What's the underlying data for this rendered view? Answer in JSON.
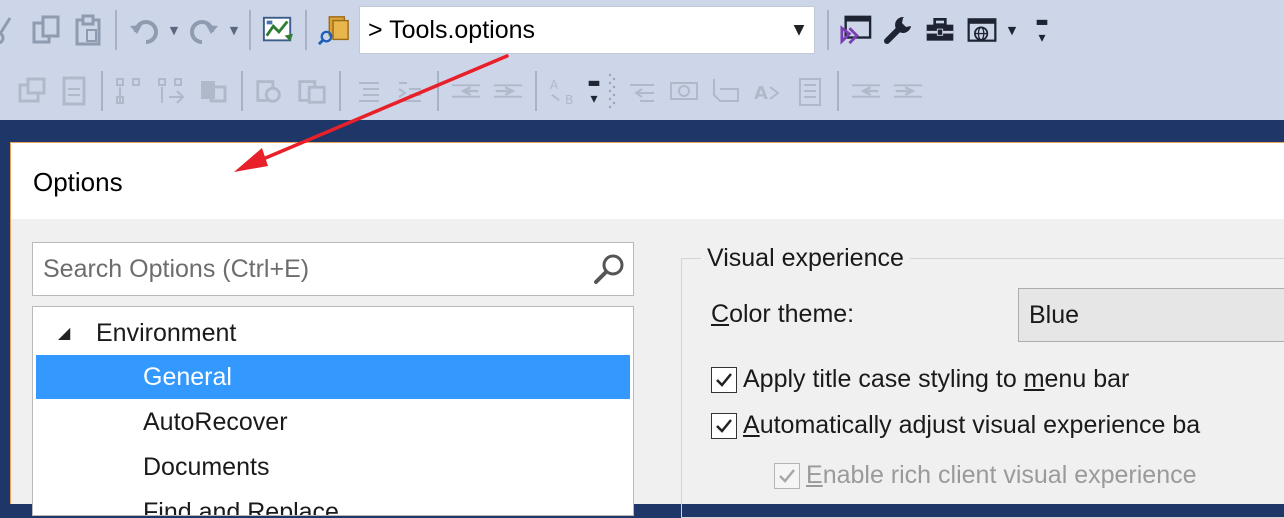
{
  "command_box": {
    "value": "> Tools.options"
  },
  "dialog": {
    "title": "Options",
    "search": {
      "placeholder": "Search Options (Ctrl+E)"
    },
    "tree": [
      {
        "label": "Environment",
        "expanded": true,
        "level": 0
      },
      {
        "label": "General",
        "level": 1,
        "selected": true
      },
      {
        "label": "AutoRecover",
        "level": 1
      },
      {
        "label": "Documents",
        "level": 1
      },
      {
        "label": "Find and Replace",
        "level": 1
      }
    ],
    "visual": {
      "group_label": "Visual experience",
      "color_theme_label_pre": "",
      "color_theme_label_ul": "C",
      "color_theme_label_post": "olor theme:",
      "color_theme_value": "Blue",
      "checkboxes": [
        {
          "pre": "Apply title case styling to ",
          "ul": "m",
          "post": "enu bar",
          "checked": true,
          "enabled": true
        },
        {
          "pre": "",
          "ul": "A",
          "post": "utomatically adjust visual experience ba",
          "checked": true,
          "enabled": true
        },
        {
          "pre": "",
          "ul": "E",
          "post": "nable rich client visual experience",
          "checked": true,
          "enabled": false
        }
      ]
    }
  },
  "colors": {
    "toolbar_bg": "#cdd6e8",
    "shell_bg": "#1f3668",
    "selection": "#3399ff",
    "dialog_border": "#e9a35e",
    "annotation_arrow": "#e8202a"
  },
  "icons": {
    "toolbar_row1": [
      "cut-icon",
      "copy-icon",
      "paste-icon",
      "undo-icon",
      "redo-icon",
      "chart-icon",
      "find-in-files-icon",
      "vs-project-icon",
      "wrench-icon",
      "toolbox-icon",
      "browser-icon"
    ],
    "toolbar_row2": [
      "toolbar-row2-disabled-icons"
    ]
  }
}
